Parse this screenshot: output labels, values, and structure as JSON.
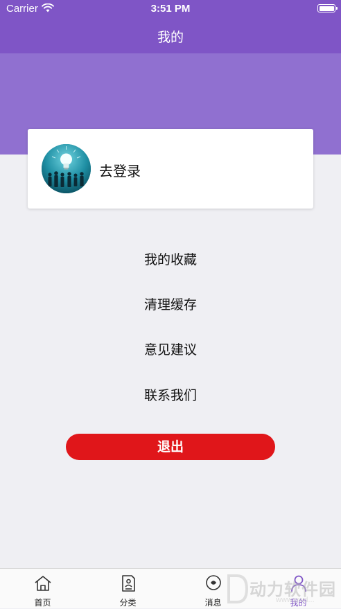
{
  "status_bar": {
    "carrier": "Carrier",
    "time": "3:51 PM"
  },
  "nav": {
    "title": "我的"
  },
  "profile": {
    "login_label": "去登录"
  },
  "menu": [
    {
      "label": "我的收藏"
    },
    {
      "label": "清理缓存"
    },
    {
      "label": "意见建议"
    },
    {
      "label": "联系我们"
    }
  ],
  "logout": {
    "label": "退出"
  },
  "tabs": [
    {
      "label": "首页",
      "icon": "home-icon"
    },
    {
      "label": "分类",
      "icon": "category-icon"
    },
    {
      "label": "消息",
      "icon": "message-icon"
    },
    {
      "label": "我的",
      "icon": "profile-icon",
      "active": true
    }
  ],
  "watermark": {
    "text": "动力软件园",
    "sub": "www.pwd..."
  },
  "colors": {
    "brand": "#7f55c6",
    "header_bg": "#9070d0",
    "logout": "#e0161a",
    "page_bg": "#efeff3"
  }
}
